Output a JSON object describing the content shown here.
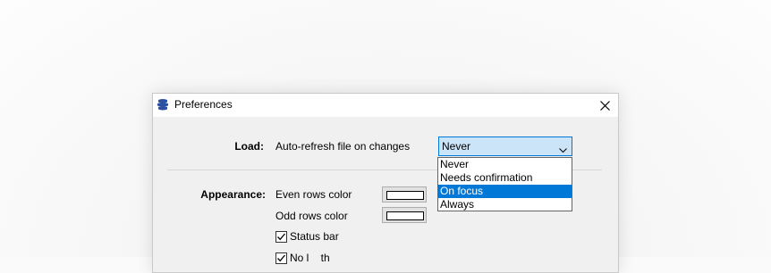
{
  "window": {
    "title": "Preferences",
    "icon": "app-stack-icon",
    "close_icon": "close-icon",
    "accent_color": "#0078d7"
  },
  "load": {
    "label": "Load:",
    "auto_refresh_label": "Auto-refresh file on changes",
    "selected_value": "Never",
    "options": [
      "Never",
      "Needs confirmation",
      "On focus",
      "Always"
    ],
    "highlighted_option": "On focus"
  },
  "appearance": {
    "label": "Appearance:",
    "even_rows_label": "Even rows color",
    "odd_rows_label": "Odd rows color",
    "even_rows_color": "#ffffff",
    "odd_rows_color": "#ffffff",
    "status_bar_label": "Status bar",
    "status_bar_checked": true,
    "partial_option_label": "No l    th",
    "partial_option_checked": true
  }
}
